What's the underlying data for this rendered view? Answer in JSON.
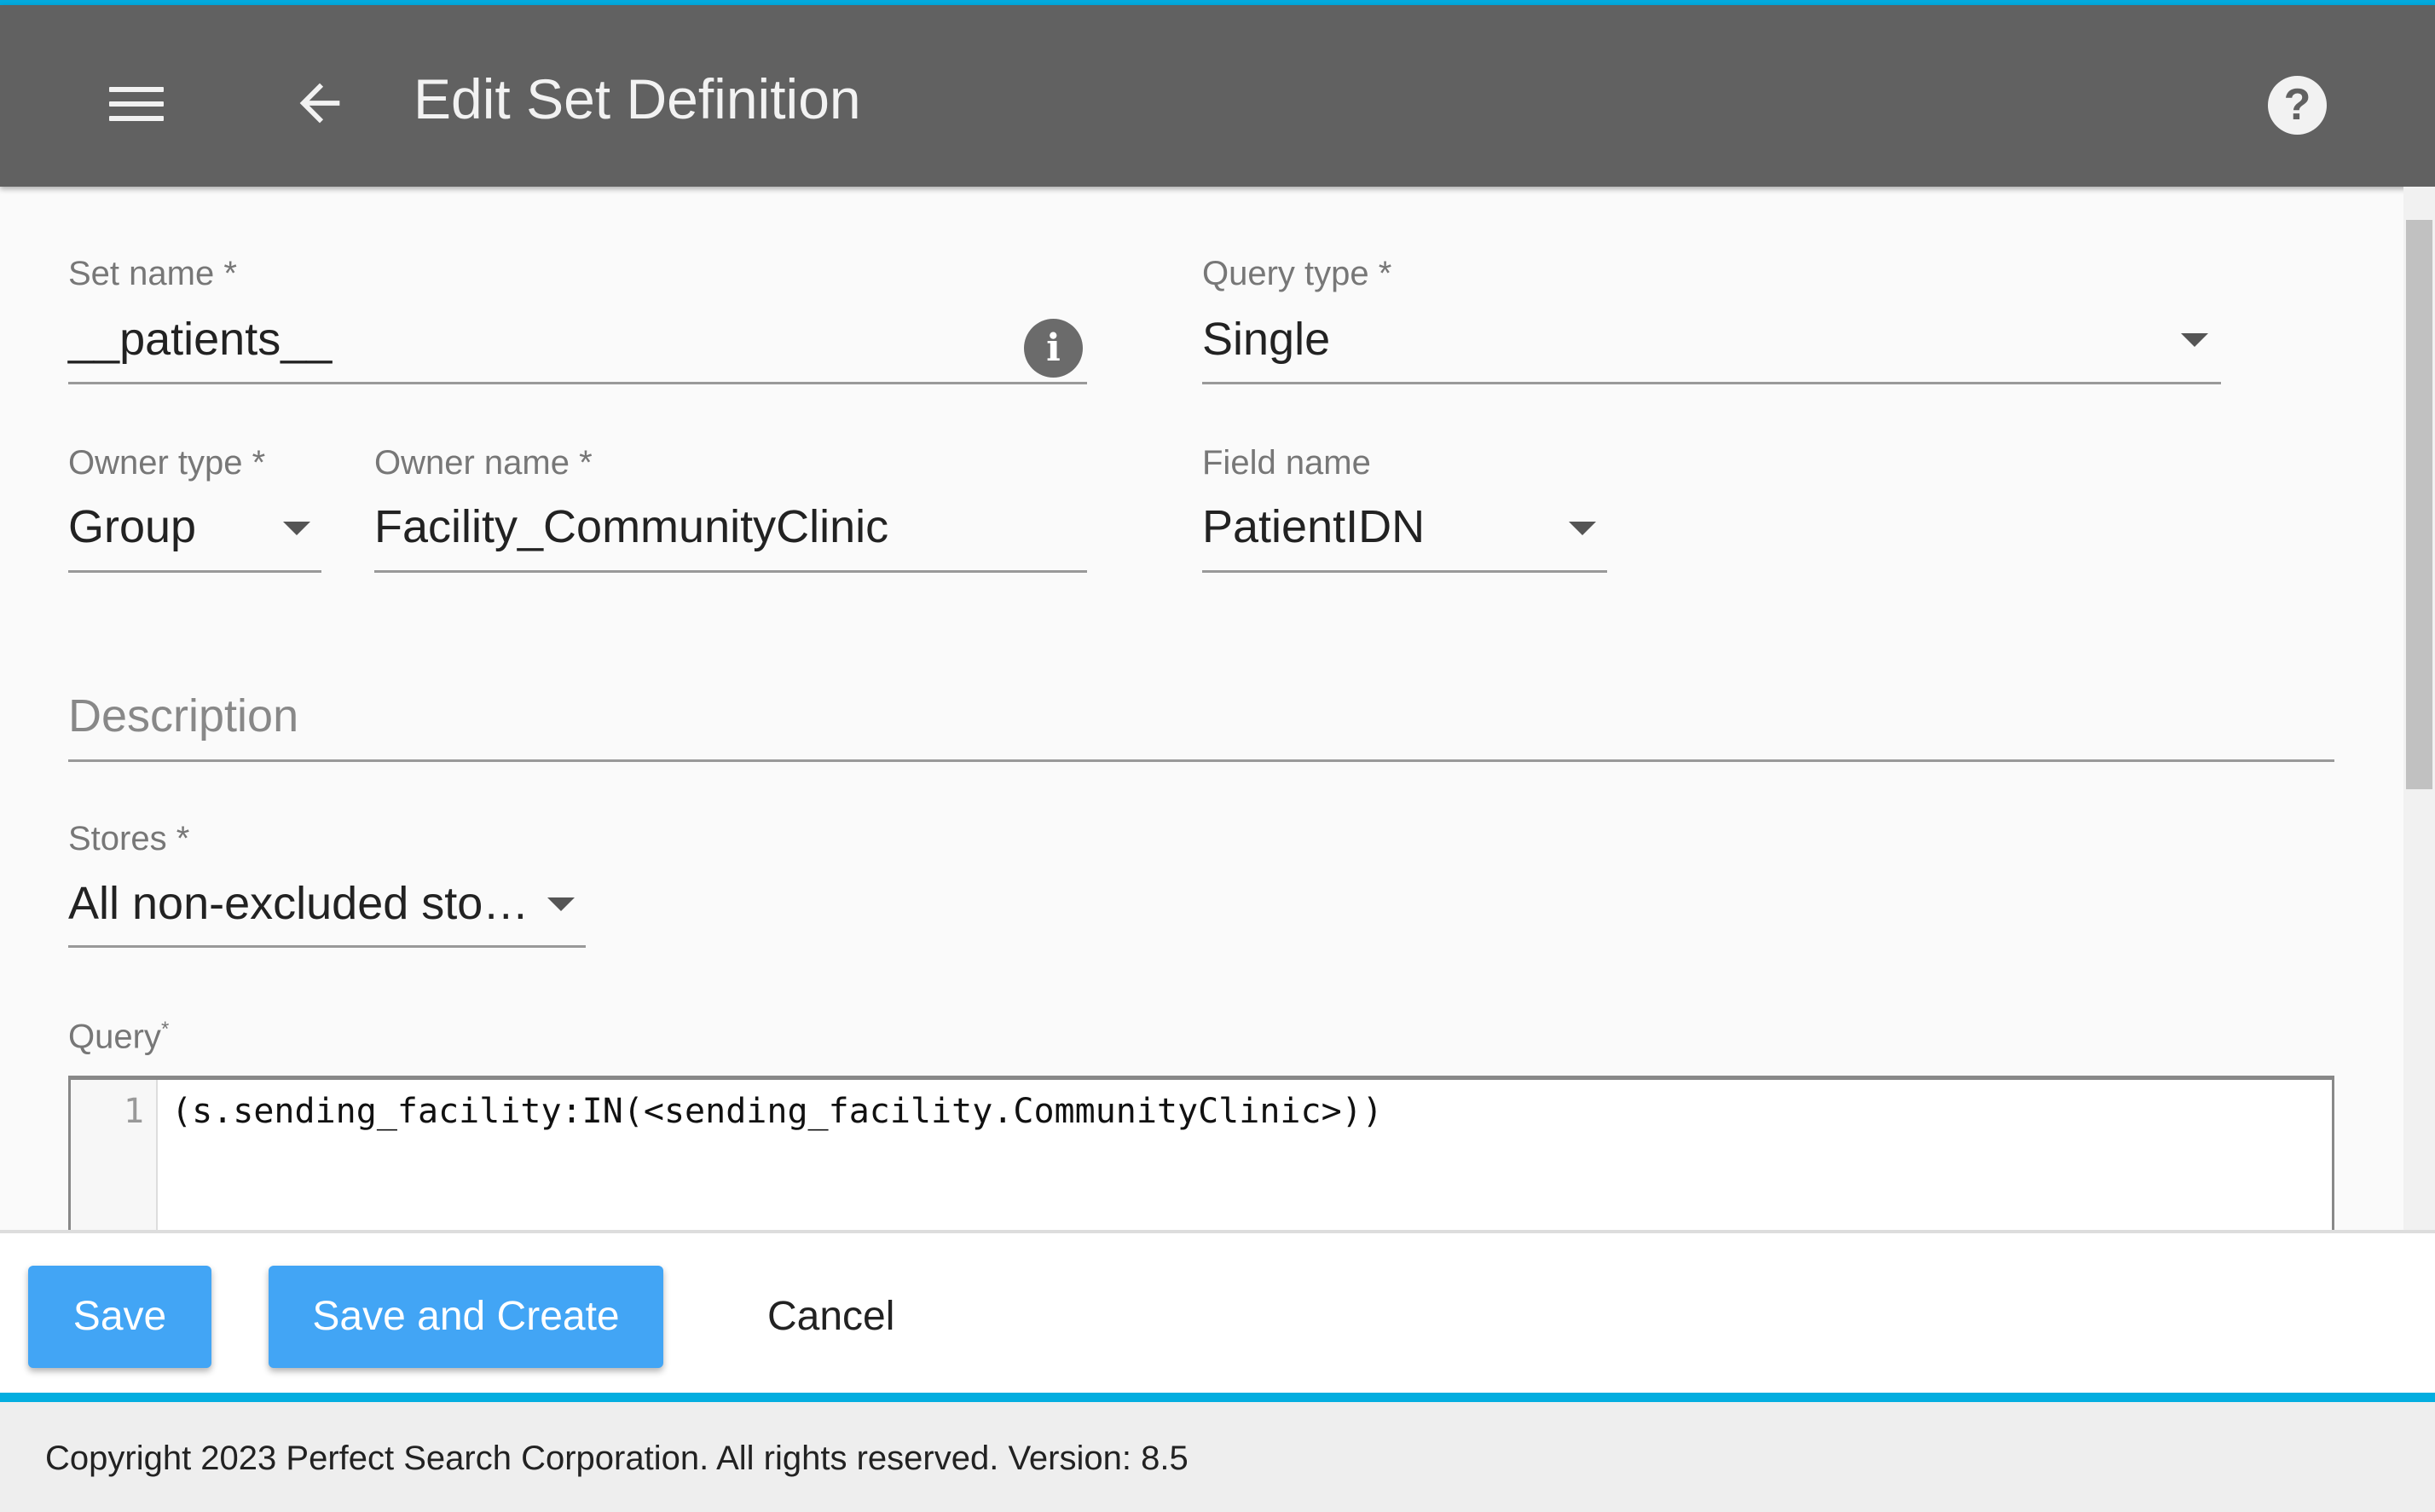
{
  "header": {
    "title": "Edit Set Definition",
    "menu_icon": "hamburger-icon",
    "back_icon": "arrow-left-icon",
    "help_icon": "help-circle-icon",
    "help_glyph": "?"
  },
  "form": {
    "set_name": {
      "label": "Set name *",
      "value": "__patients__",
      "info_glyph": "i"
    },
    "query_type": {
      "label": "Query type *",
      "value": "Single"
    },
    "owner_type": {
      "label": "Owner type *",
      "value": "Group"
    },
    "owner_name": {
      "label": "Owner name *",
      "value": "Facility_CommunityClinic"
    },
    "field_name": {
      "label": "Field name",
      "value": "PatientIDN"
    },
    "description": {
      "placeholder": "Description",
      "value": ""
    },
    "stores": {
      "label": "Stores *",
      "value": "All non-excluded sto…"
    },
    "query": {
      "label": "Query",
      "required_mark": "*",
      "line_number": "1",
      "code": "(s.sending_facility:IN(<sending_facility.CommunityClinic>))"
    }
  },
  "actions": {
    "save": "Save",
    "save_and_create": "Save and Create",
    "cancel": "Cancel"
  },
  "footer": {
    "text": "Copyright 2023 Perfect Search Corporation. All rights reserved. Version: 8.5"
  },
  "colors": {
    "header": "#616161",
    "accent": "#03aee0",
    "button": "#42a5f5"
  }
}
